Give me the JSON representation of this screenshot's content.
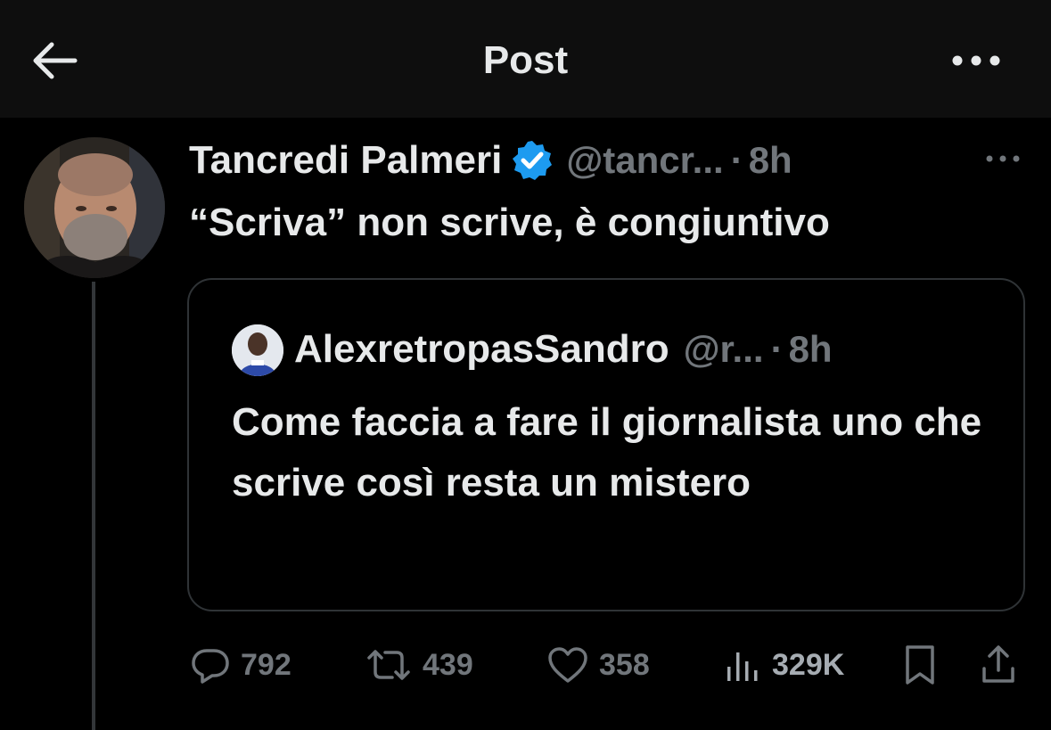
{
  "header": {
    "title": "Post",
    "back_icon": "back-arrow-icon",
    "more_icon": "more-horizontal-icon"
  },
  "tweet": {
    "author_name": "Tancredi Palmeri",
    "verified": true,
    "handle": "@tancr...",
    "separator": "·",
    "time": "8h",
    "text": "“Scriva” non scrive, è congiuntivo"
  },
  "quoted": {
    "author_name": "AlexretropasSandro",
    "handle": "@r...",
    "separator": "·",
    "time": "8h",
    "text": "Come faccia a fare il giornalista uno che scrive così resta un mistero"
  },
  "actions": {
    "replies": "792",
    "reposts": "439",
    "likes": "358",
    "views": "329K"
  },
  "colors": {
    "background": "#000000",
    "topbar": "#0e0e0e",
    "text_primary": "#e7e9ea",
    "text_secondary": "#71767b",
    "verified_blue": "#1d9bf0",
    "border": "#2f3336"
  }
}
